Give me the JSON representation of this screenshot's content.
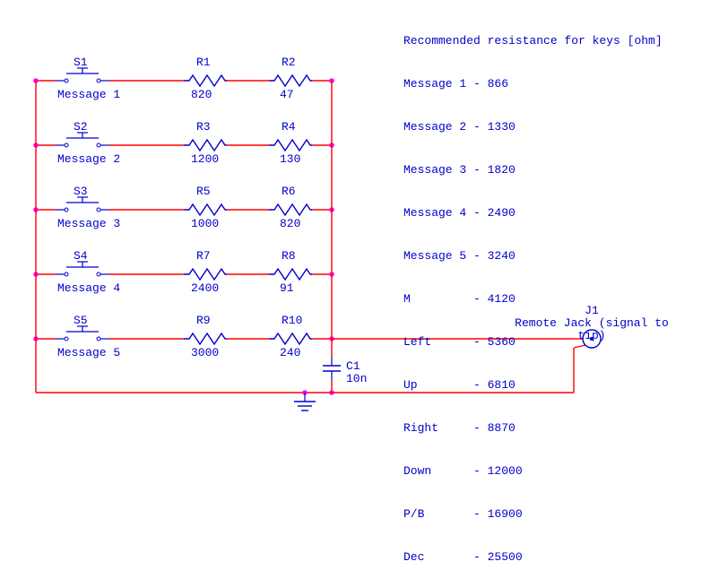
{
  "rows": [
    {
      "sw_label": "S1",
      "sw_name": "Message 1",
      "rA_label": "R1",
      "rA_val": "820",
      "rB_label": "R2",
      "rB_val": "47"
    },
    {
      "sw_label": "S2",
      "sw_name": "Message 2",
      "rA_label": "R3",
      "rA_val": "1200",
      "rB_label": "R4",
      "rB_val": "130"
    },
    {
      "sw_label": "S3",
      "sw_name": "Message 3",
      "rA_label": "R5",
      "rA_val": "1000",
      "rB_label": "R6",
      "rB_val": "820"
    },
    {
      "sw_label": "S4",
      "sw_name": "Message 4",
      "rA_label": "R7",
      "rA_val": "2400",
      "rB_label": "R8",
      "rB_val": "91"
    },
    {
      "sw_label": "S5",
      "sw_name": "Message 5",
      "rA_label": "R9",
      "rA_val": "3000",
      "rB_label": "R10",
      "rB_val": "240"
    }
  ],
  "cap": {
    "label": "C1",
    "val": "10n"
  },
  "jack": {
    "label": "J1",
    "desc": "Remote Jack (signal to tip)"
  },
  "notes": {
    "title": "Recommended resistance for keys [ohm]",
    "lines": [
      "Message 1 - 866",
      "Message 2 - 1330",
      "Message 3 - 1820",
      "Message 4 - 2490",
      "Message 5 - 3240",
      "M         - 4120",
      "Left      - 5360",
      "Up        - 6810",
      "Right     - 8870",
      "Down      - 12000",
      "P/B       - 16900",
      "Dec       - 25500"
    ]
  },
  "chart_data": {
    "type": "table",
    "title": "Recommended resistance for keys [ohm]",
    "rows": [
      {
        "key": "Message 1",
        "ohm": 866
      },
      {
        "key": "Message 2",
        "ohm": 1330
      },
      {
        "key": "Message 3",
        "ohm": 1820
      },
      {
        "key": "Message 4",
        "ohm": 2490
      },
      {
        "key": "Message 5",
        "ohm": 3240
      },
      {
        "key": "M",
        "ohm": 4120
      },
      {
        "key": "Left",
        "ohm": 5360
      },
      {
        "key": "Up",
        "ohm": 6810
      },
      {
        "key": "Right",
        "ohm": 8870
      },
      {
        "key": "Down",
        "ohm": 12000
      },
      {
        "key": "P/B",
        "ohm": 16900
      },
      {
        "key": "Dec",
        "ohm": 25500
      }
    ]
  }
}
